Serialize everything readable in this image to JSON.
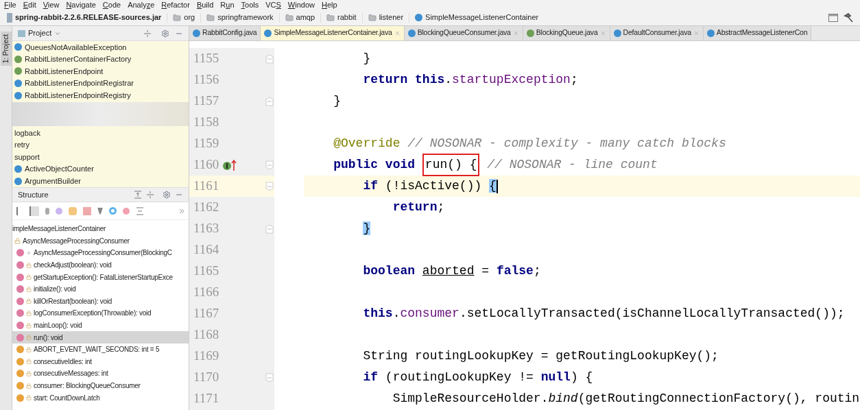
{
  "menu": [
    {
      "key": "F",
      "rest": "ile"
    },
    {
      "key": "E",
      "rest": "dit"
    },
    {
      "key": "V",
      "rest": "iew"
    },
    {
      "key": "N",
      "rest": "avigate"
    },
    {
      "key": "C",
      "rest": "ode"
    },
    {
      "lead": "Analy",
      "key": "z",
      "rest": "e"
    },
    {
      "key": "R",
      "rest": "efactor"
    },
    {
      "key": "B",
      "rest": "uild"
    },
    {
      "lead": "R",
      "key": "u",
      "rest": "n"
    },
    {
      "key": "T",
      "rest": "ools"
    },
    {
      "lead": "VC",
      "key": "S"
    },
    {
      "key": "W",
      "rest": "indow"
    },
    {
      "key": "H",
      "rest": "elp"
    }
  ],
  "breadcrumb": [
    {
      "label": "spring-rabbit-2.2.6.RELEASE-sources.jar",
      "kind": "jar"
    },
    {
      "label": "org",
      "kind": "package"
    },
    {
      "label": "springframework",
      "kind": "package"
    },
    {
      "label": "amqp",
      "kind": "package"
    },
    {
      "label": "rabbit",
      "kind": "package"
    },
    {
      "label": "listener",
      "kind": "package"
    },
    {
      "label": "SimpleMessageListenerContainer",
      "kind": "class"
    }
  ],
  "tool_strip": {
    "label": "1: Project"
  },
  "project": {
    "title": "Project",
    "items": [
      {
        "label": "QueuesNotAvailableException",
        "kind": "class"
      },
      {
        "label": "RabbitListenerContainerFactory",
        "kind": "interface"
      },
      {
        "label": "RabbitListenerEndpoint",
        "kind": "interface"
      },
      {
        "label": "RabbitListenerEndpointRegistrar",
        "kind": "class"
      },
      {
        "label": "RabbitListenerEndpointRegistry",
        "kind": "class"
      },
      {
        "kind": "redacted"
      },
      {
        "label": "logback",
        "kind": "folder"
      },
      {
        "label": "retry",
        "kind": "folder"
      },
      {
        "label": "support",
        "kind": "folder"
      },
      {
        "label": "ActiveObjectCounter",
        "kind": "class"
      },
      {
        "label": "ArgumentBuilder",
        "kind": "class"
      }
    ]
  },
  "structure": {
    "title": "Structure",
    "tree": [
      {
        "label": "impleMessageListenerContainer",
        "selected": false,
        "children": [
          {
            "label": "AsyncMessageProcessingConsumer",
            "kind": "lock",
            "selected": false,
            "children": [
              {
                "label": "AsyncMessageProcessingConsumer(BlockingC",
                "kind": "method",
                "private": false,
                "selected": false
              },
              {
                "label": "checkAdjust(boolean): void",
                "kind": "method",
                "private": true,
                "selected": false
              },
              {
                "label": "getStartupException(): FatalListenerStartupExce",
                "kind": "method",
                "private": true,
                "selected": false
              },
              {
                "label": "initialize(): void",
                "kind": "method",
                "private": true,
                "selected": false
              },
              {
                "label": "killOrRestart(boolean): void",
                "kind": "method",
                "private": true,
                "selected": false
              },
              {
                "label": "logConsumerException(Throwable): void",
                "kind": "method",
                "private": true,
                "selected": false
              },
              {
                "label": "mainLoop(): void",
                "kind": "method",
                "private": true,
                "selected": false
              },
              {
                "label": "run(): void",
                "kind": "method",
                "private": true,
                "selected": true
              },
              {
                "label": "ABORT_EVENT_WAIT_SECONDS: int = 5",
                "kind": "field",
                "private": true,
                "selected": false
              },
              {
                "label": "consecutiveIdles: int",
                "kind": "field",
                "private": true,
                "selected": false
              },
              {
                "label": "consecutiveMessages: int",
                "kind": "field",
                "private": true,
                "selected": false
              },
              {
                "label": "consumer: BlockingQueueConsumer",
                "kind": "field",
                "private": true,
                "selected": false
              },
              {
                "label": "start: CountDownLatch",
                "kind": "field",
                "private": true,
                "selected": false
              }
            ]
          }
        ]
      }
    ]
  },
  "tabs": [
    {
      "label": "RabbitConfig.java",
      "kind": "class",
      "selected": false,
      "closable": false
    },
    {
      "label": "SimpleMessageListenerContainer.java",
      "kind": "class",
      "selected": true,
      "closable": true
    },
    {
      "label": "BlockingQueueConsumer.java",
      "kind": "class",
      "selected": false,
      "closable": true
    },
    {
      "label": "BlockingQueue.java",
      "kind": "interface",
      "selected": false,
      "closable": true
    },
    {
      "label": "DefaultConsumer.java",
      "kind": "class",
      "selected": false,
      "closable": true
    },
    {
      "label": "AbstractMessageListenerCon",
      "kind": "class",
      "selected": false,
      "closable": false
    }
  ],
  "editor": {
    "lines": [
      {
        "number": "1155",
        "fold_start": false,
        "fold_end": true,
        "implements_marker": false,
        "tokens": [
          {
            "t": "        }",
            "kind": "plain"
          }
        ]
      },
      {
        "number": "1156",
        "fold_start": false,
        "fold_end": false,
        "implements_marker": false,
        "tokens": [
          {
            "t": "        return this",
            "kind": "keyword"
          },
          {
            "t": ".",
            "kind": "plain"
          },
          {
            "t": "startupException",
            "kind": "field"
          },
          {
            "t": ";",
            "kind": "plain"
          }
        ]
      },
      {
        "number": "1157",
        "fold_start": false,
        "fold_end": true,
        "implements_marker": false,
        "tokens": [
          {
            "t": "    }",
            "kind": "plain"
          }
        ]
      },
      {
        "number": "1158",
        "fold_start": false,
        "fold_end": false,
        "implements_marker": false
      },
      {
        "number": "1159",
        "fold_start": false,
        "fold_end": false,
        "implements_marker": false,
        "tokens": [
          {
            "t": "    @Override",
            "kind": "annotation"
          },
          {
            "t": " // NOSONAR - complexity - many catch blocks",
            "kind": "comment"
          }
        ]
      },
      {
        "number": "1160",
        "fold_start": true,
        "fold_end": false,
        "implements_marker": true,
        "tokens": [
          {
            "t": "    public void ",
            "kind": "keyword"
          },
          {
            "t": "run() {",
            "kind": "plain",
            "boxed": true
          },
          {
            "t": " // NOSONAR - line count",
            "kind": "comment"
          }
        ]
      },
      {
        "number": "1161",
        "fold_start": true,
        "fold_end": false,
        "implements_marker": false,
        "current": true,
        "tokens": [
          {
            "t": "        if",
            "kind": "keyword"
          },
          {
            "t": " (!isActive()) ",
            "kind": "plain"
          },
          {
            "t": "{",
            "kind": "match"
          }
        ]
      },
      {
        "number": "1162",
        "fold_start": false,
        "fold_end": false,
        "implements_marker": false,
        "tokens": [
          {
            "t": "            return",
            "kind": "keyword"
          },
          {
            "t": ";",
            "kind": "plain"
          }
        ]
      },
      {
        "number": "1163",
        "fold_start": false,
        "fold_end": true,
        "implements_marker": false,
        "tokens": [
          {
            "t": "        }",
            "kind": "match"
          }
        ]
      },
      {
        "number": "1164",
        "fold_start": false,
        "fold_end": false,
        "implements_marker": false
      },
      {
        "number": "1165",
        "fold_start": false,
        "fold_end": false,
        "implements_marker": false,
        "tokens": [
          {
            "t": "        boolean ",
            "kind": "keyword"
          },
          {
            "t": "aborted",
            "kind": "underline"
          },
          {
            "t": " = ",
            "kind": "plain"
          },
          {
            "t": "false",
            "kind": "keyword"
          },
          {
            "t": ";",
            "kind": "plain"
          }
        ]
      },
      {
        "number": "1166",
        "fold_start": false,
        "fold_end": false,
        "implements_marker": false
      },
      {
        "number": "1167",
        "fold_start": false,
        "fold_end": false,
        "implements_marker": false,
        "tokens": [
          {
            "t": "        this",
            "kind": "keyword"
          },
          {
            "t": ".",
            "kind": "plain"
          },
          {
            "t": "consumer",
            "kind": "field"
          },
          {
            "t": ".setLocallyTransacted(isChannelLocallyTransacted());",
            "kind": "plain"
          }
        ]
      },
      {
        "number": "1168",
        "fold_start": false,
        "fold_end": false,
        "implements_marker": false
      },
      {
        "number": "1169",
        "fold_start": false,
        "fold_end": false,
        "implements_marker": false,
        "tokens": [
          {
            "t": "        String routingLookupKey = getRoutingLookupKey();",
            "kind": "plain"
          }
        ]
      },
      {
        "number": "1170",
        "fold_start": true,
        "fold_end": false,
        "implements_marker": false,
        "tokens": [
          {
            "t": "        if",
            "kind": "keyword"
          },
          {
            "t": " (routingLookupKey != ",
            "kind": "plain"
          },
          {
            "t": "null",
            "kind": "keyword"
          },
          {
            "t": ") {",
            "kind": "plain"
          }
        ]
      },
      {
        "number": "1171",
        "fold_start": false,
        "fold_end": false,
        "implements_marker": false,
        "tokens": [
          {
            "t": "            SimpleResourceHolder.",
            "kind": "plain"
          },
          {
            "t": "bind",
            "kind": "static"
          },
          {
            "t": "(getRoutingConnectionFactory(), routin",
            "kind": "plain"
          }
        ]
      }
    ]
  }
}
